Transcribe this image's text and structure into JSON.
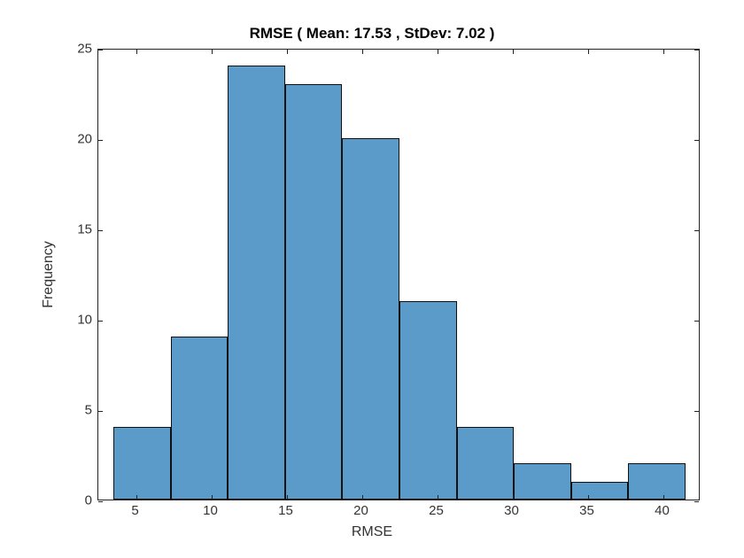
{
  "chart_data": {
    "type": "bar",
    "title": "RMSE ( Mean: 17.53 , StDev: 7.02 )",
    "xlabel": "RMSE",
    "ylabel": "Frequency",
    "xlim": [
      2.5,
      42.5
    ],
    "ylim": [
      0,
      25
    ],
    "xticks": [
      5,
      10,
      15,
      20,
      25,
      30,
      35,
      40
    ],
    "yticks": [
      0,
      5,
      10,
      15,
      20,
      25
    ],
    "bin_edges": [
      3.5,
      7.3,
      11.1,
      14.9,
      18.7,
      22.5,
      26.3,
      30.1,
      33.9,
      37.7,
      41.5
    ],
    "values": [
      4,
      9,
      24,
      23,
      20,
      11,
      4,
      2,
      1,
      2
    ],
    "bar_color": "#5b9bc9",
    "edge_color": "#111"
  }
}
